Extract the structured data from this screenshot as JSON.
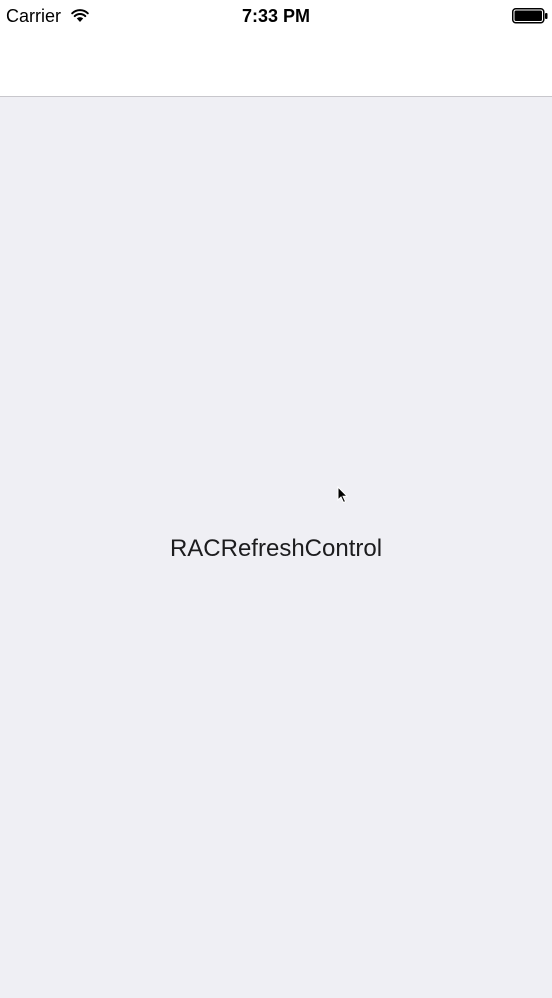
{
  "status_bar": {
    "carrier": "Carrier",
    "time": "7:33 PM",
    "wifi_icon": "wifi-icon",
    "battery_icon": "battery-icon"
  },
  "nav_bar": {
    "title": ""
  },
  "content": {
    "label": "RACRefreshControl",
    "background": "#efeff4"
  },
  "cursor_icon": "mouse-pointer-icon"
}
